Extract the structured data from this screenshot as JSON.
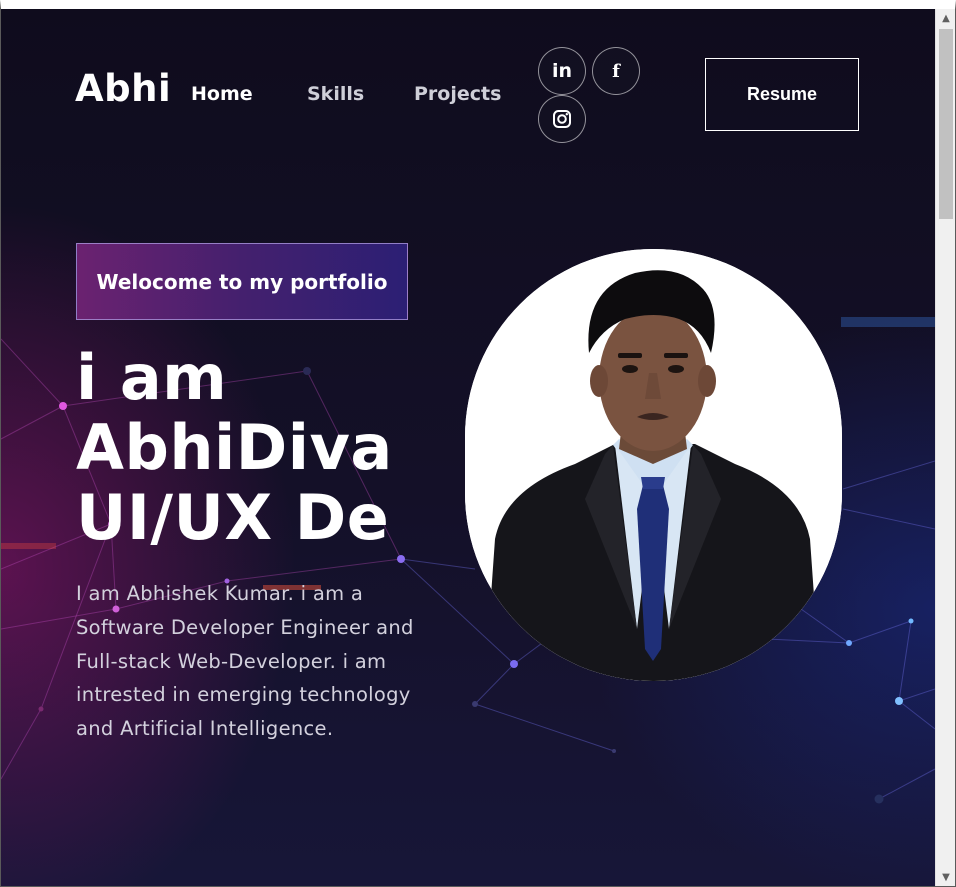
{
  "nav": {
    "logo": "Abhi",
    "links": [
      "Home",
      "Skills",
      "Projects"
    ],
    "social": {
      "linkedin": "in",
      "facebook": "f"
    },
    "resume_label": "Resume"
  },
  "hero": {
    "badge": "Welocome to my portfolio",
    "headline_lines": [
      "i am",
      "AbhiDiva",
      "UI/UX De"
    ],
    "bio": "I am Abhishek Kumar. i am a Software Developer Engineer and Full-stack Web-Developer. i am intrested in emerging technology and Artificial Intelligence."
  },
  "icons": {
    "linkedin": "linkedin-icon",
    "facebook": "facebook-icon",
    "instagram": "instagram-icon",
    "scroll_up": "scroll-up-arrow-icon",
    "scroll_down": "scroll-down-arrow-icon"
  },
  "colors": {
    "background": "#121020",
    "badge_start": "#6b2270",
    "badge_end": "#2c1f74",
    "text": "#ffffff",
    "muted_text": "#d3d1dd"
  }
}
